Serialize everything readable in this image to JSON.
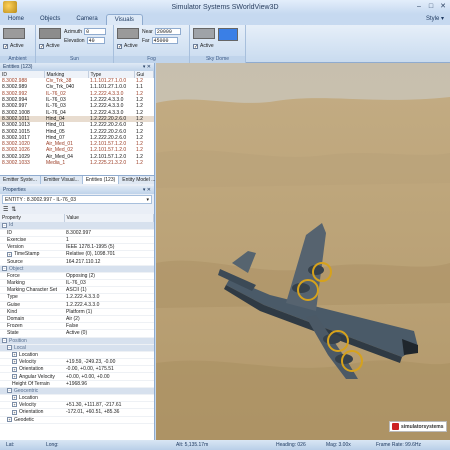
{
  "window": {
    "title": "Simulator Systems SWorldView3D"
  },
  "ribbon_tabs": [
    {
      "label": "Home",
      "active": false
    },
    {
      "label": "Objects",
      "active": false
    },
    {
      "label": "Camera",
      "active": false
    },
    {
      "label": "Visuals",
      "active": true
    }
  ],
  "style_menu": "Style ▾",
  "ribbon": {
    "ambient": {
      "label": "Ambient",
      "active_label": "Active"
    },
    "sun": {
      "label": "Sun",
      "active_label": "Active",
      "azimuth_label": "Azimuth",
      "azimuth": "0",
      "elevation_label": "Elevation",
      "elevation": "40"
    },
    "fog": {
      "label": "Fog",
      "active_label": "Active",
      "near_label": "Near",
      "near": "20000",
      "far_label": "Far",
      "far": "45000"
    },
    "sky_dome": {
      "label": "Sky Dome",
      "active_label": "Active"
    }
  },
  "entities_panel": {
    "title": "Entities (123)",
    "columns": [
      "ID",
      "Marking",
      "Type",
      "Gui"
    ],
    "rows": [
      {
        "id": "8.3002.988",
        "marking": "Civ_Trk_38",
        "type": "1.1.101.27.1.0.0",
        "gui": "1.2",
        "style": "r-red"
      },
      {
        "id": "8.3002.989",
        "marking": "Civ_Trk_040",
        "type": "1.1.101.27.1.0.0",
        "gui": "1.1",
        "style": "r-dark"
      },
      {
        "id": "8.3002.992",
        "marking": "IL-76_02",
        "type": "1.2.222.4.3.3.0",
        "gui": "1.2",
        "style": "r-red"
      },
      {
        "id": "8.3002.994",
        "marking": "IL-76_03",
        "type": "1.2.222.4.3.3.0",
        "gui": "1.2",
        "style": "r-dark"
      },
      {
        "id": "8.3002.997",
        "marking": "IL-76_03",
        "type": "1.2.222.4.3.3.0",
        "gui": "1.2",
        "style": "r-dark"
      },
      {
        "id": "8.3002.1008",
        "marking": "IL-76_04",
        "type": "1.2.222.4.3.3.0",
        "gui": "1.2",
        "style": "r-dark"
      },
      {
        "id": "8.3002.1011",
        "marking": "Hind_04",
        "type": "1.2.222.20.2.6.0",
        "gui": "1.2",
        "style": "r-hl"
      },
      {
        "id": "8.3002.1013",
        "marking": "Hind_01",
        "type": "1.2.222.20.2.6.0",
        "gui": "1.2",
        "style": "r-dark"
      },
      {
        "id": "8.3002.1015",
        "marking": "Hind_05",
        "type": "1.2.222.20.2.6.0",
        "gui": "1.2",
        "style": "r-dark"
      },
      {
        "id": "8.3002.1017",
        "marking": "Hind_07",
        "type": "1.2.222.20.2.6.0",
        "gui": "1.2",
        "style": "r-dark"
      },
      {
        "id": "8.3002.1020",
        "marking": "Air_Med_01",
        "type": "1.2.101.57.1.2.0",
        "gui": "1.2",
        "style": "r-red"
      },
      {
        "id": "8.3002.1026",
        "marking": "Air_Med_02",
        "type": "1.2.101.57.1.2.0",
        "gui": "1.2",
        "style": "r-red"
      },
      {
        "id": "8.3002.1029",
        "marking": "Air_Med_04",
        "type": "1.2.101.57.1.2.0",
        "gui": "1.2",
        "style": "r-dark"
      },
      {
        "id": "8.3002.1033",
        "marking": "Media_1",
        "type": "1.2.225.21.3.2.0",
        "gui": "1.2",
        "style": "r-red"
      }
    ],
    "bottom_tabs": [
      {
        "label": "Emitter Syste...",
        "active": false
      },
      {
        "label": "Emitter Visual...",
        "active": false
      },
      {
        "label": "Entities (123)",
        "active": true
      },
      {
        "label": "Entity Model ...",
        "active": false
      }
    ]
  },
  "properties_panel": {
    "title": "Properties",
    "entity_selector": "ENTITY : 8.3002.997 - IL-76_03",
    "columns": [
      "Property",
      "Value"
    ],
    "rows": [
      {
        "kind": "cat",
        "key": "Id",
        "value": "",
        "level": 0
      },
      {
        "kind": "row",
        "key": "ID",
        "value": "8.3002.997",
        "level": 1
      },
      {
        "kind": "row",
        "key": "Exercise",
        "value": "1",
        "level": 1
      },
      {
        "kind": "row",
        "key": "Version",
        "value": "IEEE 1278.1-1995 (5)",
        "level": 1
      },
      {
        "kind": "row",
        "key": "TimeStamp",
        "value": "Relative (0), 1098.701",
        "level": 1,
        "plus": true
      },
      {
        "kind": "row",
        "key": "Source",
        "value": "164.217.110.12",
        "level": 1
      },
      {
        "kind": "cat",
        "key": "Object",
        "value": "",
        "level": 0
      },
      {
        "kind": "row",
        "key": "Force",
        "value": "Opposing (2)",
        "level": 1
      },
      {
        "kind": "row",
        "key": "Marking",
        "value": "IL-76_03",
        "level": 1
      },
      {
        "kind": "row",
        "key": "Marking Character Set",
        "value": "ASCII (1)",
        "level": 1
      },
      {
        "kind": "row",
        "key": "Type",
        "value": "1.2.222.4.3.3.0",
        "level": 1
      },
      {
        "kind": "row",
        "key": "Guise",
        "value": "1.2.222.4.3.3.0",
        "level": 1
      },
      {
        "kind": "row",
        "key": "Kind",
        "value": "Platform (1)",
        "level": 1
      },
      {
        "kind": "row",
        "key": "Domain",
        "value": "Air (2)",
        "level": 1
      },
      {
        "kind": "row",
        "key": "Frozen",
        "value": "False",
        "level": 1
      },
      {
        "kind": "row",
        "key": "State",
        "value": "Active (0)",
        "level": 1
      },
      {
        "kind": "cat",
        "key": "Position",
        "value": "",
        "level": 0
      },
      {
        "kind": "cat",
        "key": "Local",
        "value": "",
        "level": 1
      },
      {
        "kind": "row",
        "key": "Location",
        "value": "",
        "level": 2,
        "plus": true
      },
      {
        "kind": "row",
        "key": "Velocity",
        "value": "+19.59, -249.23, -0.00",
        "level": 2,
        "plus": true
      },
      {
        "kind": "row",
        "key": "Orientation",
        "value": "-0.00, +0.00, +175.51",
        "level": 2,
        "plus": true
      },
      {
        "kind": "row",
        "key": "Angular Velocity",
        "value": "+0.00, +0.00, +0.00",
        "level": 2,
        "plus": true
      },
      {
        "kind": "row",
        "key": "Height Of Terrain",
        "value": "+1968.96",
        "level": 2
      },
      {
        "kind": "cat",
        "key": "Geocentric",
        "value": "",
        "level": 1
      },
      {
        "kind": "row",
        "key": "Location",
        "value": "",
        "level": 2,
        "plus": true
      },
      {
        "kind": "row",
        "key": "Velocity",
        "value": "+51.30, +111.87, -217.61",
        "level": 2,
        "plus": true
      },
      {
        "kind": "row",
        "key": "Orientation",
        "value": "-172.01, +60.51, +85.36",
        "level": 2,
        "plus": true
      },
      {
        "kind": "row",
        "key": "Geodetic",
        "value": "",
        "level": 1,
        "plus": true
      }
    ]
  },
  "status_bar": {
    "lat": "Lat:",
    "long": "Long:",
    "alt": "Alt: 5,135.17m",
    "heading": "Heading: 026",
    "mag": "Mag: 3.00x",
    "frame_rate": "Frame Rate: 99.6Hz"
  },
  "brand": "simulatorsystems"
}
